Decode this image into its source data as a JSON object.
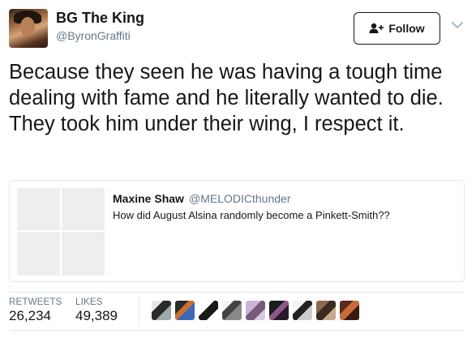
{
  "user": {
    "display_name": "BG The King",
    "handle": "@ByronGraffiti"
  },
  "follow_button": {
    "label": "Follow",
    "icon": "add-user-icon"
  },
  "menu_icon": "chevron-down-icon",
  "tweet": {
    "text": "Because they seen he was having a tough time dealing with fame and he literally wanted to die. They took him under their wing, I respect it."
  },
  "quoted_tweet": {
    "display_name": "Maxine Shaw",
    "handle": "@MELODICthunder",
    "text": "How did August Alsina randomly become a Pinkett-Smith??",
    "media_count": 4
  },
  "stats": {
    "retweets_label": "RETWEETS",
    "retweets_value": "26,234",
    "likes_label": "LIKES",
    "likes_value": "49,389"
  },
  "likers_count_shown": 9,
  "colors": {
    "text": "#14171a",
    "secondary_text": "#657786",
    "border": "#e1e8ed"
  }
}
